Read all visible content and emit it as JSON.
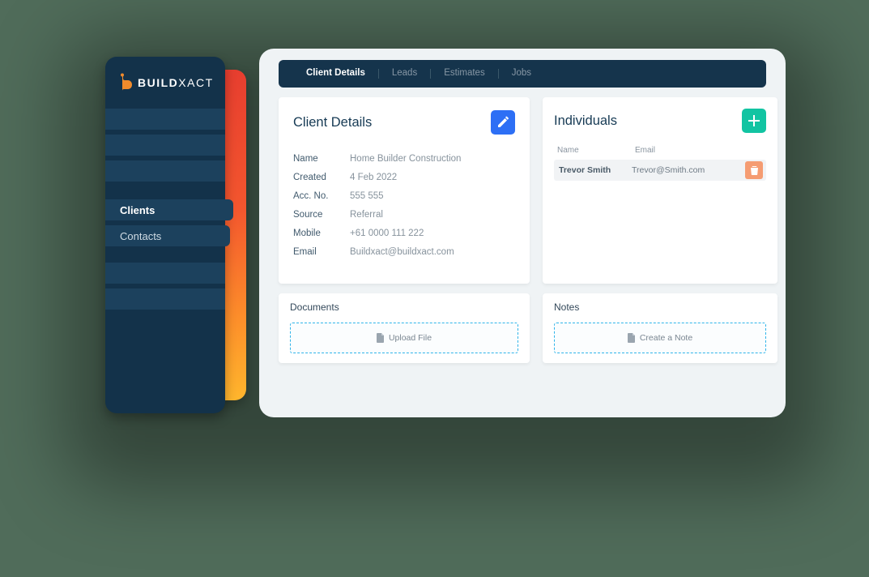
{
  "brand": {
    "bold": "BUILD",
    "light": "XACT"
  },
  "sidebar": {
    "items": [
      {
        "label": "",
        "active": false
      },
      {
        "label": "",
        "active": false
      },
      {
        "label": "",
        "active": false
      },
      {
        "label": "Clients",
        "active": true
      },
      {
        "label": "Contacts",
        "active": false
      },
      {
        "label": "",
        "active": false
      },
      {
        "label": "",
        "active": false
      }
    ]
  },
  "tabs": [
    {
      "label": "Client Details",
      "active": true
    },
    {
      "label": "Leads",
      "active": false
    },
    {
      "label": "Estimates",
      "active": false
    },
    {
      "label": "Jobs",
      "active": false
    }
  ],
  "details": {
    "title": "Client Details",
    "rows": [
      {
        "label": "Name",
        "value": "Home Builder Construction"
      },
      {
        "label": "Created",
        "value": "4 Feb 2022"
      },
      {
        "label": "Acc. No.",
        "value": "555 555"
      },
      {
        "label": "Source",
        "value": "Referral"
      },
      {
        "label": "Mobile",
        "value": "+61 0000 111 222"
      },
      {
        "label": "Email",
        "value": "Buildxact@buildxact.com"
      }
    ]
  },
  "individuals": {
    "title": "Individuals",
    "headers": {
      "name": "Name",
      "email": "Email"
    },
    "rows": [
      {
        "name": "Trevor Smith",
        "email": "Trevor@Smith.com"
      }
    ]
  },
  "documents": {
    "title": "Documents",
    "action": "Upload File"
  },
  "notes": {
    "title": "Notes",
    "action": "Create a Note"
  },
  "colors": {
    "accent_blue": "#2d6ff5",
    "accent_teal": "#12c4a2",
    "dashed": "#2fb4e9"
  }
}
